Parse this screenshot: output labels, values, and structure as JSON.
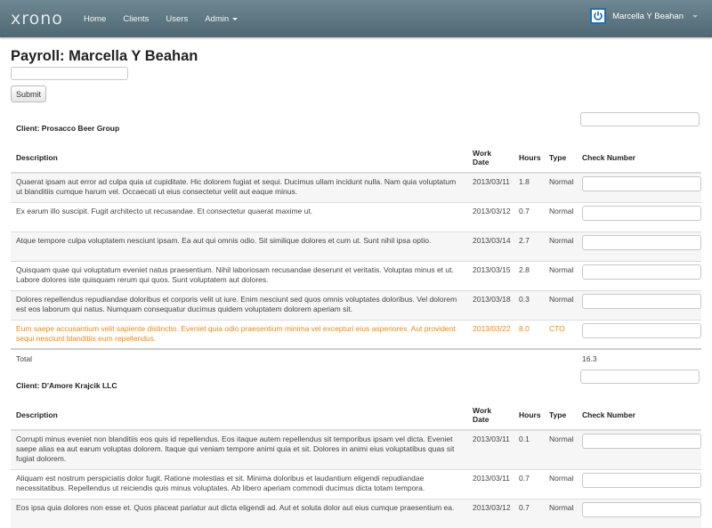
{
  "nav": {
    "brand": "xrono",
    "items": [
      "Home",
      "Clients",
      "Users",
      "Admin"
    ],
    "user": "Marcella Y Beahan"
  },
  "page": {
    "title": "Payroll: Marcella Y Beahan",
    "submit": "Submit"
  },
  "columns": {
    "description": "Description",
    "work_date": "Work Date",
    "hours": "Hours",
    "type": "Type",
    "check_number": "Check Number"
  },
  "clients": [
    {
      "name": "Client: Prosacco Beer Group",
      "rows": [
        {
          "description": "Quaerat ipsam aut error ad culpa quia ut cupiditate. Hic dolorem fugiat et sequi. Ducimus ullam incidunt nulla. Nam quia voluptatum ut blanditiis cumque harum vel. Occaecati ut eius consectetur velit aut eaque minus.",
          "date": "2013/03/11",
          "hours": "1.8",
          "type": "Normal"
        },
        {
          "description": "Ex earum illo suscipit. Fugit architecto ut recusandae. Et consectetur quaerat maxime ut.",
          "date": "2013/03/12",
          "hours": "0.7",
          "type": "Normal"
        },
        {
          "description": "Atque tempore culpa voluptatem nesciunt ipsam. Ea aut qui omnis odio. Sit similique dolores et cum ut. Sunt nihil ipsa optio.",
          "date": "2013/03/14",
          "hours": "2.7",
          "type": "Normal"
        },
        {
          "description": "Quisquam quae qui voluptatum eveniet natus praesentium. Nihil laboriosam recusandae deserunt et veritatis. Voluptas minus et ut. Labore dolores iste quisquam rerum qui quos. Sunt voluptatem aut dolores.",
          "date": "2013/03/15",
          "hours": "2.8",
          "type": "Normal"
        },
        {
          "description": "Dolores repellendus repudiandae doloribus et corporis velit ut iure. Enim nesciunt sed quos omnis voluptates doloribus. Vel dolorem est eos laborum qui natus. Numquam consequatur ducimus quidem voluptatem dolorem aperiam sit.",
          "date": "2013/03/18",
          "hours": "0.3",
          "type": "Normal"
        },
        {
          "description": "Eum saepe accusantium velit sapiente distinctio. Eveniet quia odio praesentium minima vel excepturi eius asperiores. Aut provident sequi nesciunt blanditiis eum repellendus.",
          "date": "2013/03/22",
          "hours": "8.0",
          "type": "CTO"
        }
      ],
      "total_label": "Total",
      "total_value": "16.3"
    },
    {
      "name": "Client: D'Amore Krajcik LLC",
      "rows": [
        {
          "description": "Corrupti minus eveniet non blanditiis eos quis id repellendus. Eos itaque autem repellendus sit temporibus ipsam vel dicta. Eveniet saepe alias ea aut earum voluptas dolorem. Itaque qui veniam tempore animi quia et sit. Dolores in animi eius voluptatibus quas sit fugiat dolorem.",
          "date": "2013/03/11",
          "hours": "0.1",
          "type": "Normal"
        },
        {
          "description": "Aliquam est nostrum perspiciatis dolor fugit. Ratione molestias et sit. Minima doloribus et laudantium eligendi repudiandae necessitatibus. Repellendus ut reiciendis quis minus voluptates. Ab libero aperiam commodi ducimus dicta totam tempora.",
          "date": "2013/03/11",
          "hours": "0.7",
          "type": "Normal"
        },
        {
          "description": "Eos ipsa quia dolores non esse et. Quos placeat pariatur aut dicta eligendi ad. Aut et soluta dolor aut eius cumque praesentium ea.",
          "date": "2013/03/12",
          "hours": "0.7",
          "type": "Normal"
        }
      ]
    }
  ]
}
